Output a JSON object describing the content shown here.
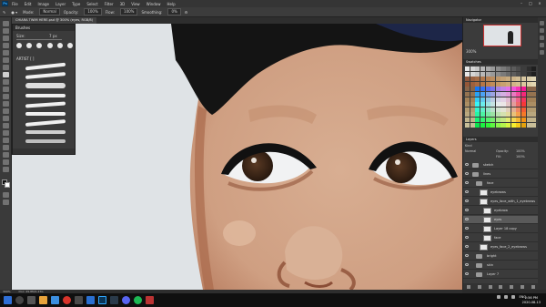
{
  "menubar": {
    "logo": "Ps",
    "items": [
      "File",
      "Edit",
      "Image",
      "Layer",
      "Type",
      "Select",
      "Filter",
      "3D",
      "View",
      "Window",
      "Help"
    ]
  },
  "options": {
    "mode_label": "Mode:",
    "mode_value": "Normal",
    "opacity_label": "Opacity:",
    "opacity_value": "100%",
    "flow_label": "Flow:",
    "flow_value": "100%",
    "smoothing_label": "Smoothing:",
    "smoothing_value": "0%"
  },
  "document": {
    "tab_title": "CHIARA TWIM HERE.psd @ 300% (eyes, RGB/8)",
    "status_zoom": "300%",
    "status_doc": "Doc: 49.8M/1.27G"
  },
  "brushes_panel": {
    "title": "Brushes",
    "size_label": "Size:",
    "size_value": "7 px",
    "group_label": "ARTIST [ ]"
  },
  "navigator": {
    "title": "Navigator",
    "zoom": "300%"
  },
  "swatches": {
    "title": "Swatches"
  },
  "layers": {
    "title": "Layers",
    "filter_label": "Kind",
    "blend_mode": "Normal",
    "opacity_label": "Opacity:",
    "opacity_value": "100%",
    "fill_label": "Fill:",
    "fill_value": "100%",
    "rows": [
      "sketch",
      "lines",
      "face",
      "eyebrows",
      "eyes_face_with_1_eyebrows",
      "eyebrow",
      "eyes",
      "Layer 18 copy",
      "face",
      "eyes_face_2_eyebrows",
      "bright",
      "skin",
      "Layer 7"
    ]
  },
  "taskbar": {
    "lang": "ENG",
    "time": "2:56 PM",
    "date": "2020-08-13"
  },
  "colors": {
    "canvas_bg": "#dfe3e6",
    "skin": "#d3a88d",
    "hair": "#141414",
    "accent": "#31a8ff"
  }
}
